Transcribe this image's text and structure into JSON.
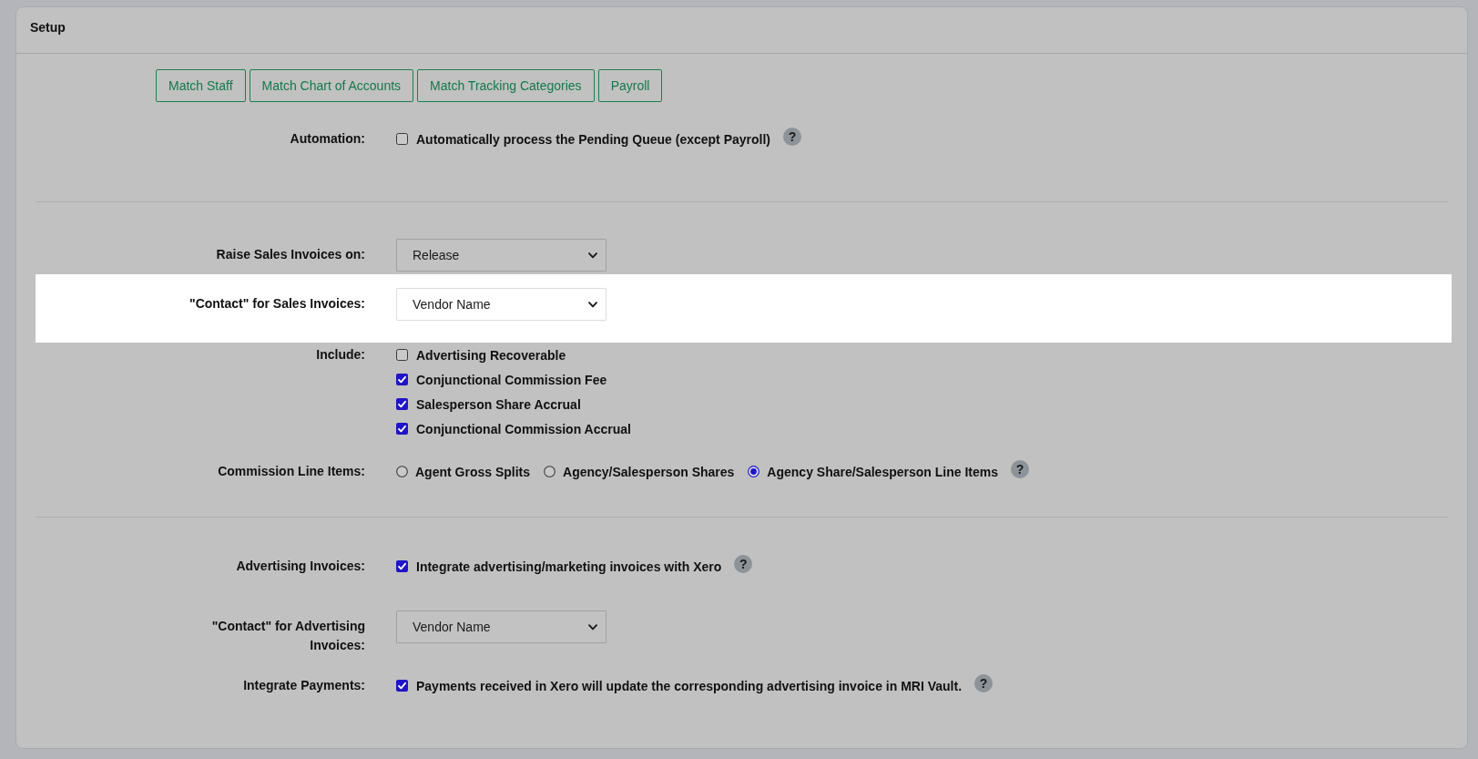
{
  "panel": {
    "title": "Setup"
  },
  "sections": [
    {
      "buttons": [
        "Match Staff",
        "Match Chart of Accounts",
        "Match Tracking Categories",
        "Payroll"
      ],
      "rows": [
        {
          "label": "Automation:",
          "kind": "checkboxes",
          "highlighted": false,
          "options": [
            {
              "label": "Automatically process the Pending Queue (except Payroll)",
              "checked": false
            }
          ],
          "help": "?"
        }
      ]
    },
    {
      "rows": [
        {
          "label": "Raise Sales Invoices on:",
          "kind": "select",
          "highlighted": false,
          "value": "Release"
        },
        {
          "label": "\"Contact\" for Sales Invoices:",
          "kind": "select",
          "highlighted": true,
          "value": "Vendor Name"
        },
        {
          "label": "Include:",
          "kind": "checkboxes",
          "highlighted": false,
          "options": [
            {
              "label": "Advertising Recoverable",
              "checked": false
            },
            {
              "label": "Conjunctional Commission Fee",
              "checked": true
            },
            {
              "label": "Salesperson Share Accrual",
              "checked": true
            },
            {
              "label": "Conjunctional Commission Accrual",
              "checked": true
            }
          ]
        },
        {
          "label": "Commission Line Items:",
          "kind": "radios",
          "highlighted": false,
          "options": [
            {
              "label": "Agent Gross Splits",
              "selected": false
            },
            {
              "label": "Agency/Salesperson Shares",
              "selected": false
            },
            {
              "label": "Agency Share/Salesperson Line Items",
              "selected": true
            }
          ],
          "help": "?"
        }
      ]
    },
    {
      "rows": [
        {
          "label": "Advertising Invoices:",
          "kind": "checkboxes",
          "highlighted": false,
          "options": [
            {
              "label": "Integrate advertising/marketing invoices with Xero",
              "checked": true
            }
          ],
          "help": "?"
        },
        {
          "label": "\"Contact\" for Advertising Invoices:",
          "kind": "select",
          "highlighted": false,
          "value": "Vendor Name"
        },
        {
          "label": "Integrate Payments:",
          "kind": "checkboxes",
          "highlighted": false,
          "options": [
            {
              "label": "Payments received in Xero will update the corresponding advertising invoice in MRI Vault.",
              "checked": true
            }
          ],
          "help": "?"
        }
      ]
    }
  ]
}
